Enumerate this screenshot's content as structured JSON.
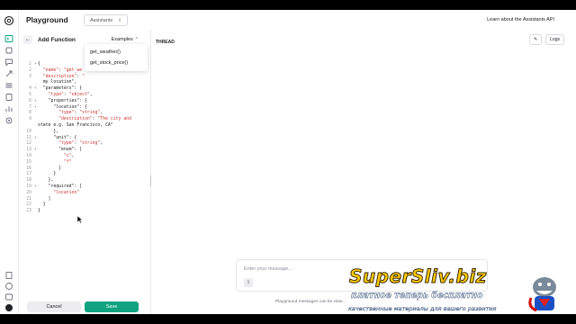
{
  "header": {
    "title": "Playground",
    "mode": "Assistants",
    "learn_link": "Learn about the Assistants API"
  },
  "left_panel": {
    "title": "Add Function",
    "examples_label": "Examples",
    "examples_options": [
      "get_weather()",
      "get_stock_price()"
    ],
    "code_lines": [
      {
        "n": "1",
        "fold": "▾",
        "text": "{"
      },
      {
        "n": "2",
        "fold": "",
        "text": "  \"name\": \"get_we"
      },
      {
        "n": "3",
        "fold": "",
        "text": "  \"description\": \""
      },
      {
        "n": "",
        "fold": "",
        "text": "  my location\","
      },
      {
        "n": "4",
        "fold": "▾",
        "text": "  \"parameters\": {"
      },
      {
        "n": "5",
        "fold": "",
        "text": "    \"type\": \"object\","
      },
      {
        "n": "6",
        "fold": "▾",
        "text": "    \"properties\": {"
      },
      {
        "n": "7",
        "fold": "▾",
        "text": "      \"location\": {"
      },
      {
        "n": "8",
        "fold": "",
        "text": "        \"type\": \"string\","
      },
      {
        "n": "9",
        "fold": "",
        "text": "        \"description\": \"The city and"
      },
      {
        "n": "",
        "fold": "",
        "text": "state e.g. San Francisco, CA\""
      },
      {
        "n": "10",
        "fold": "",
        "text": "      },"
      },
      {
        "n": "11",
        "fold": "▾",
        "text": "      \"unit\": {"
      },
      {
        "n": "12",
        "fold": "",
        "text": "        \"type\": \"string\","
      },
      {
        "n": "13",
        "fold": "▾",
        "text": "        \"enum\": ["
      },
      {
        "n": "14",
        "fold": "",
        "text": "          \"c\","
      },
      {
        "n": "15",
        "fold": "",
        "text": "          \"f\""
      },
      {
        "n": "16",
        "fold": "",
        "text": "        ]"
      },
      {
        "n": "17",
        "fold": "",
        "text": "      }"
      },
      {
        "n": "18",
        "fold": "",
        "text": "    },"
      },
      {
        "n": "19",
        "fold": "▾",
        "text": "    \"required\": ["
      },
      {
        "n": "20",
        "fold": "",
        "text": "      \"location\""
      },
      {
        "n": "21",
        "fold": "",
        "text": "    ]"
      },
      {
        "n": "22",
        "fold": "",
        "text": "  }"
      },
      {
        "n": "23",
        "fold": "",
        "text": "}"
      }
    ],
    "cancel_label": "Cancel",
    "save_label": "Save"
  },
  "thread": {
    "label": "THREAD",
    "logs_label": "Logs",
    "composer_placeholder": "Enter your message...",
    "notice": "Playground messages can be view..."
  },
  "watermark": {
    "title": "SuperSliv.biz",
    "subtitle": "платное теперь бесплатно",
    "subtitle2": "качественные материалы для вашего развития"
  },
  "rail_icons": [
    "playground-icon",
    "assistants-icon",
    "chat-icon",
    "finetune-icon",
    "batches-icon",
    "storage-icon",
    "usage-icon",
    "settings-icon"
  ],
  "rail_bottom_icons": [
    "docs-icon",
    "help-icon",
    "org-icon",
    "user-avatar-icon"
  ],
  "colors": {
    "accent_green": "#10a37f",
    "code_string": "#cc3333",
    "watermark_yellow": "#ffcc00"
  }
}
